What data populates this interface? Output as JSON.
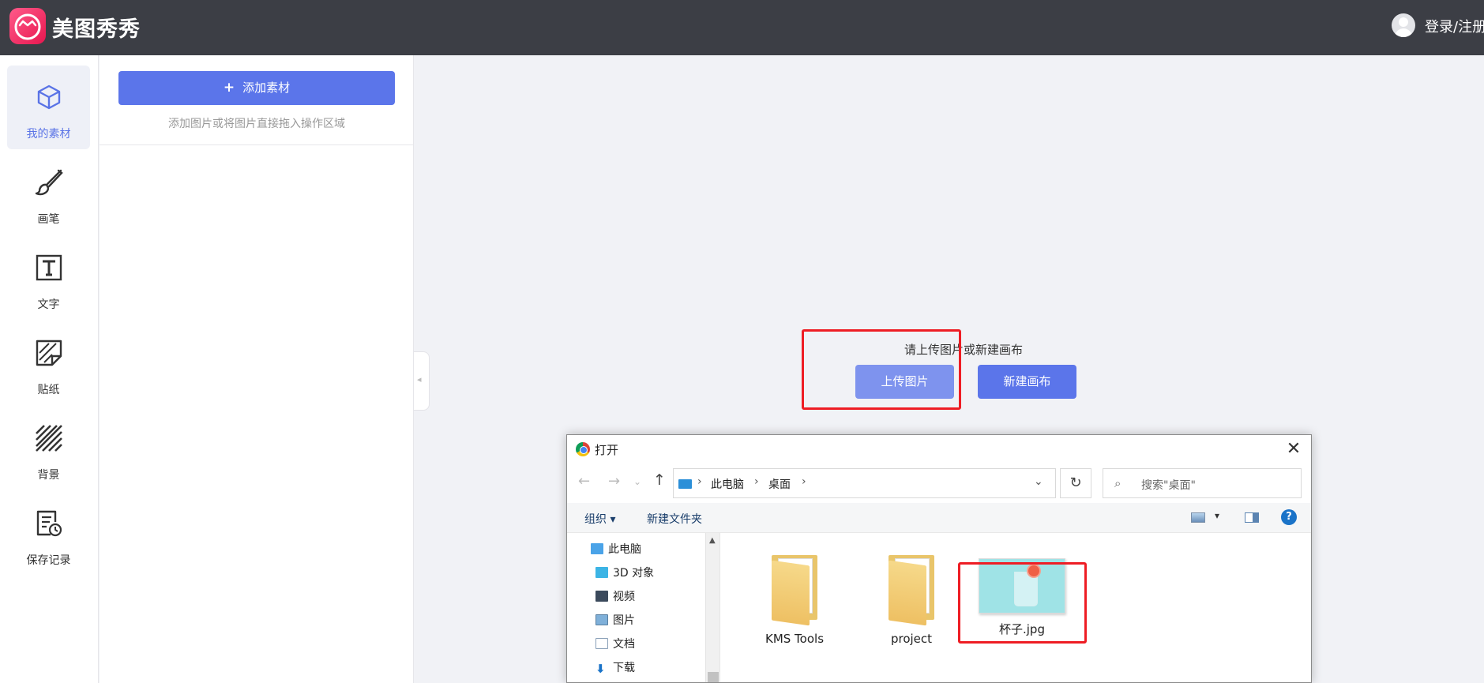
{
  "app": {
    "brand": "美图秀秀",
    "login_label": "登录/注册"
  },
  "sidebar": {
    "items": [
      {
        "label": "我的素材",
        "icon": "cube-icon",
        "active": true
      },
      {
        "label": "画笔",
        "icon": "brush-icon"
      },
      {
        "label": "文字",
        "icon": "text-icon"
      },
      {
        "label": "贴纸",
        "icon": "sticker-icon"
      },
      {
        "label": "背景",
        "icon": "background-icon"
      },
      {
        "label": "保存记录",
        "icon": "save-history-icon"
      }
    ]
  },
  "panel": {
    "add_label": "添加素材",
    "hint": "添加图片或将图片直接拖入操作区域"
  },
  "canvas": {
    "prompt": "请上传图片或新建画布",
    "upload_label": "上传图片",
    "new_canvas_label": "新建画布"
  },
  "dialog": {
    "title": "打开",
    "breadcrumb": [
      "此电脑",
      "桌面"
    ],
    "search_placeholder": "搜索\"桌面\"",
    "toolbar": {
      "organize": "组织 ▾",
      "new_folder": "新建文件夹"
    },
    "tree": [
      "此电脑",
      "3D 对象",
      "视频",
      "图片",
      "文档",
      "下载"
    ],
    "files": [
      {
        "name": "KMS Tools",
        "type": "folder"
      },
      {
        "name": "project",
        "type": "folder"
      },
      {
        "name": "杯子.jpg",
        "type": "image"
      }
    ]
  },
  "colors": {
    "accent": "#5b75ea",
    "topbar": "#3c3e45",
    "highlight": "#ee1d24"
  }
}
